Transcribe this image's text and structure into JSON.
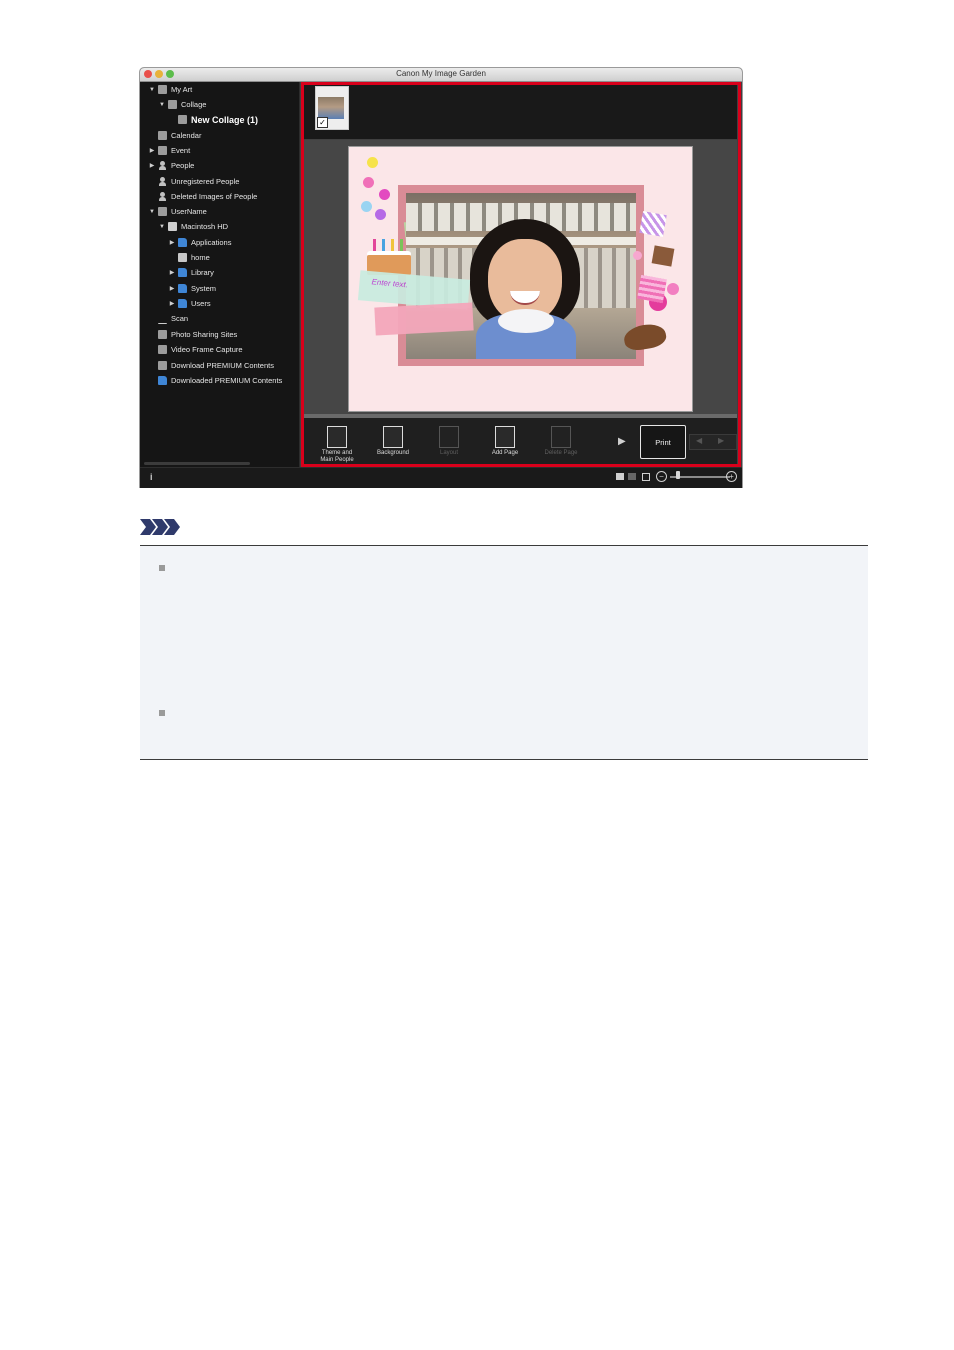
{
  "window": {
    "title": "Canon My Image Garden"
  },
  "sidebar": {
    "items": [
      {
        "label": "My Art",
        "depth": 0,
        "expanded": "▼",
        "icon": "my-art-icon"
      },
      {
        "label": "Collage",
        "depth": 1,
        "expanded": "▼",
        "icon": "collage-icon"
      },
      {
        "label": "New Collage (1)",
        "depth": 2,
        "expanded": "",
        "icon": "collage-item-icon",
        "selected": true
      },
      {
        "label": "Calendar",
        "depth": 0,
        "expanded": "",
        "icon": "calendar-icon"
      },
      {
        "label": "Event",
        "depth": 0,
        "expanded": "▶",
        "icon": "event-icon"
      },
      {
        "label": "People",
        "depth": 0,
        "expanded": "▶",
        "icon": "people-icon"
      },
      {
        "label": "Unregistered People",
        "depth": 0,
        "expanded": "",
        "icon": "unregistered-people-icon"
      },
      {
        "label": "Deleted Images of People",
        "depth": 0,
        "expanded": "",
        "icon": "deleted-people-icon"
      },
      {
        "label": "UserName",
        "depth": 0,
        "expanded": "▼",
        "icon": "computer-icon"
      },
      {
        "label": "Macintosh HD",
        "depth": 1,
        "expanded": "▼",
        "icon": "drive-icon"
      },
      {
        "label": "Applications",
        "depth": 2,
        "expanded": "▶",
        "icon": "folder-icon"
      },
      {
        "label": "home",
        "depth": 2,
        "expanded": "",
        "icon": "disk-icon"
      },
      {
        "label": "Library",
        "depth": 2,
        "expanded": "▶",
        "icon": "folder-icon"
      },
      {
        "label": "System",
        "depth": 2,
        "expanded": "▶",
        "icon": "folder-icon"
      },
      {
        "label": "Users",
        "depth": 2,
        "expanded": "▶",
        "icon": "folder-icon"
      },
      {
        "label": "Scan",
        "depth": 0,
        "expanded": "",
        "icon": "scan-icon"
      },
      {
        "label": "Photo Sharing Sites",
        "depth": 0,
        "expanded": "",
        "icon": "photo-sharing-icon"
      },
      {
        "label": "Video Frame Capture",
        "depth": 0,
        "expanded": "",
        "icon": "video-capture-icon"
      },
      {
        "label": "Download PREMIUM Contents",
        "depth": 0,
        "expanded": "",
        "icon": "download-icon"
      },
      {
        "label": "Downloaded PREMIUM Contents",
        "depth": 0,
        "expanded": "",
        "icon": "downloaded-folder-icon"
      }
    ]
  },
  "canvas": {
    "placeholder_text": "Enter text."
  },
  "toolbar": {
    "theme_label_line1": "Theme and",
    "theme_label_line2": "Main People",
    "background_label": "Background",
    "layout_label": "Layout",
    "add_page_label": "Add Page",
    "delete_page_label": "Delete Page",
    "print_label": "Print"
  },
  "colors": {
    "highlight": "#d9001b",
    "canvas_bg": "#fbe6e8",
    "sidebar_bg": "#151515"
  }
}
